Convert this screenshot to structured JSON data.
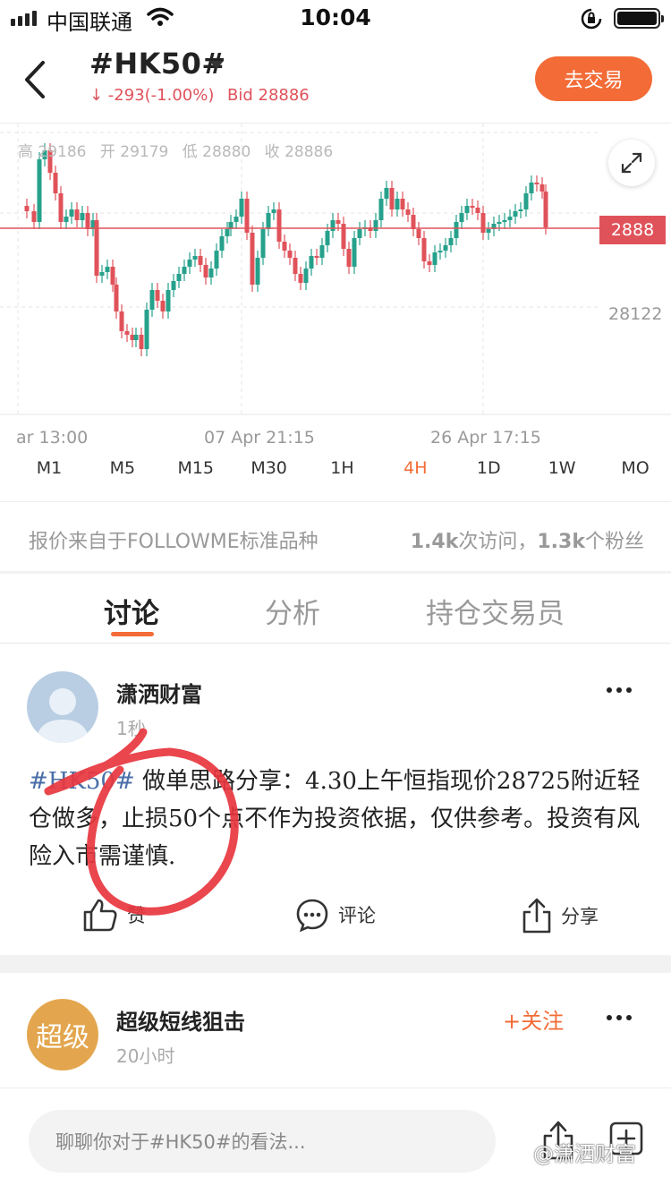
{
  "status_bar": {
    "carrier": "中国联通",
    "time": "10:04"
  },
  "header": {
    "symbol": "#HK50#",
    "change": "↓ -293(-1.00%)",
    "bid": "Bid 28886",
    "trade_button": "去交易"
  },
  "chart": {
    "ohlc": {
      "high": "高 29186",
      "open": "开 29179",
      "low": "低 28880",
      "close": "收 28886"
    },
    "current_price_label": "2888",
    "price_axis_label": "28122",
    "x_labels": [
      "ar 13:00",
      "07 Apr 21:15",
      "26 Apr 17:15"
    ],
    "up_color": "#26a18b",
    "down_color": "#e0525a"
  },
  "timeframes": {
    "items": [
      "M1",
      "M5",
      "M15",
      "M30",
      "1H",
      "4H",
      "1D",
      "1W",
      "MO"
    ],
    "active": "4H"
  },
  "info": {
    "source": "报价来自于FOLLOWME标准品种",
    "visits": "1.4k",
    "visits_label": "次访问，",
    "fans": "1.3k",
    "fans_label": "个粉丝"
  },
  "tabs": {
    "discussion": "讨论",
    "analysis": "分析",
    "traders": "持仓交易员"
  },
  "post1": {
    "author": "潇洒财富",
    "time": "1秒",
    "tag": "#HK50#",
    "body": " 做单思路分享：4.30上午恒指现价28725附近轻仓做多，止损50个点不作为投资依据，仅供参考。投资有风险入市需谨慎.",
    "like_label": "赞",
    "comment_label": "评论",
    "share_label": "分享"
  },
  "post2": {
    "avatar_text": "超级",
    "author": "超级短线狙击",
    "time": "20小时",
    "follow_label": "+关注"
  },
  "bottom": {
    "input_placeholder": "聊聊你对于#HK50#的看法...",
    "watermark": "@潇洒财富"
  },
  "accent_color": "#f36b36"
}
